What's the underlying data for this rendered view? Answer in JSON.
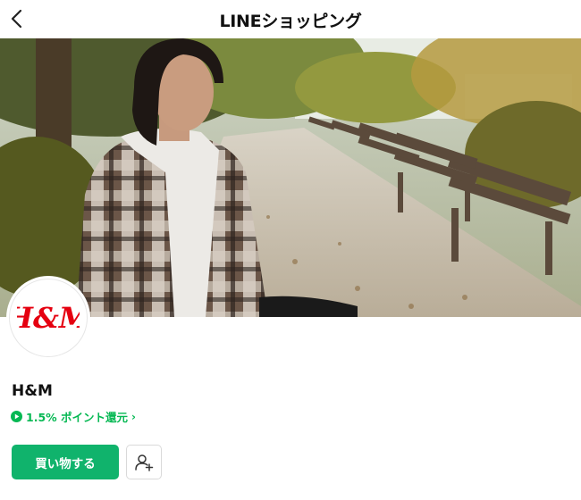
{
  "header": {
    "title": "LINEショッピング",
    "back_icon": "chevron-left-icon"
  },
  "banner": {
    "icon": "hm-campaign-banner-image"
  },
  "shop": {
    "logo_text": "H&M",
    "name": "H&M",
    "points_text": "1.5% ポイント還元",
    "points_icon": "line-points-icon",
    "chevron": "›"
  },
  "actions": {
    "shop_label": "買い物する",
    "follow_icon": "add-friend-icon"
  },
  "colors": {
    "accent": "#10b36c",
    "points": "#06b853",
    "brand_red": "#e50010"
  }
}
